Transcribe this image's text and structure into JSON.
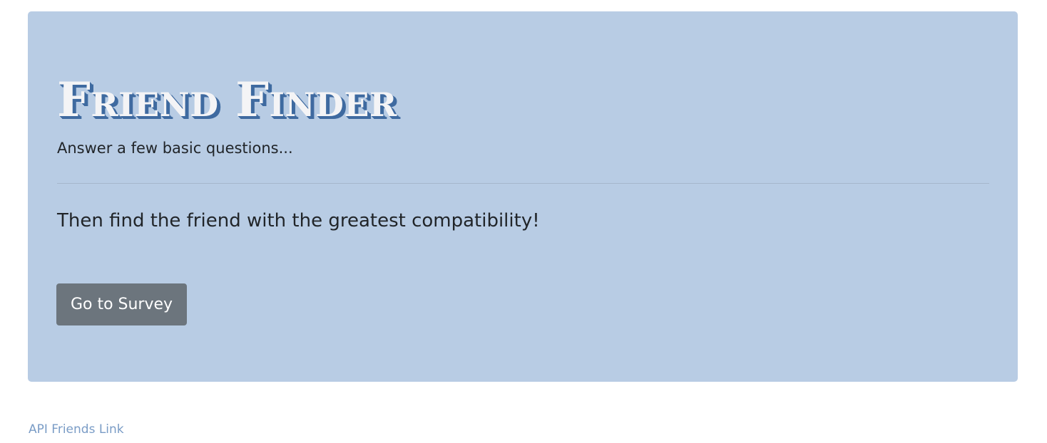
{
  "jumbotron": {
    "title": "Friend Finder",
    "subtitle": "Answer a few basic questions...",
    "lead": "Then find the friend with the greatest compatibility!",
    "button_label": "Go to Survey"
  },
  "footer": {
    "link_label": "API Friends Link"
  },
  "colors": {
    "jumbotron_background": "#b8cce4",
    "title_text": "#f4f4f6",
    "title_shadow": "#3f6aa0",
    "button_background": "#6c757d",
    "link": "#7a9cc6"
  }
}
